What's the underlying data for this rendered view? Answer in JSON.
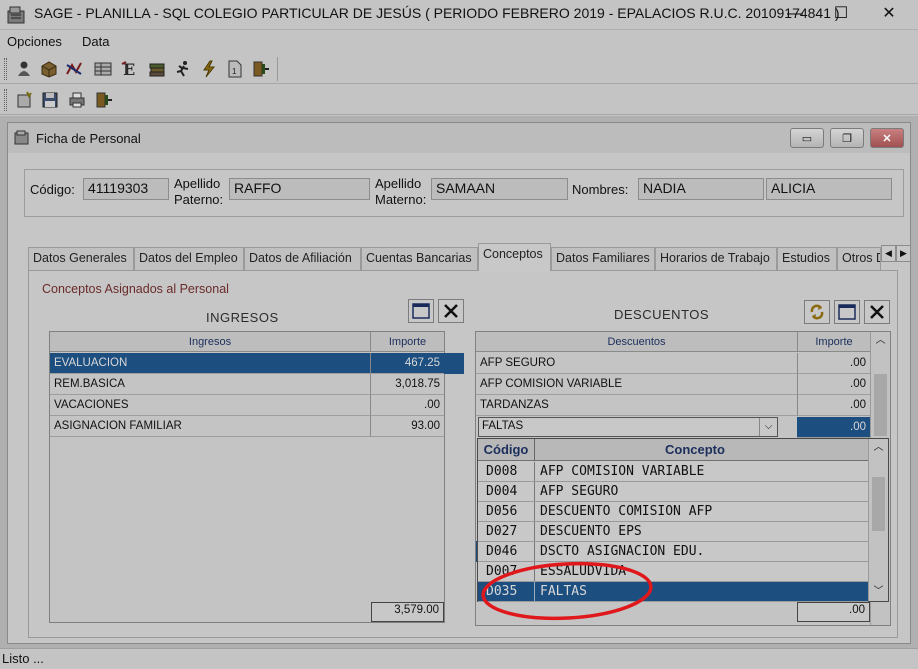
{
  "window": {
    "title": "SAGE - PLANILLA - SQL  COLEGIO PARTICULAR DE JESÚS ( PERIODO FEBRERO 2019 - EPALACIOS  R.U.C. 20109174841 )",
    "minimize": "—",
    "maximize": "☐",
    "close": "✕"
  },
  "menu": {
    "items": [
      "Opciones",
      "Data"
    ]
  },
  "child": {
    "title": "Ficha de Personal",
    "minimize": "▭",
    "restore": "❐",
    "close": "✕"
  },
  "employee": {
    "codigo_label": "Código:",
    "codigo": "41119303",
    "ap_paterno_label_1": "Apellido",
    "ap_paterno_label_2": "Paterno:",
    "ap_paterno": "RAFFO",
    "ap_materno_label_1": "Apellido",
    "ap_materno_label_2": "Materno:",
    "ap_materno": "SAMAAN",
    "nombres_label": "Nombres:",
    "nombre1": "NADIA",
    "nombre2": "ALICIA"
  },
  "tabs": [
    "Datos Generales",
    "Datos del Empleo",
    "Datos de Afiliación",
    "Cuentas Bancarias",
    "Conceptos",
    "Datos Familiares",
    "Horarios de Trabajo",
    "Estudios",
    "Otros D"
  ],
  "active_tab": "Conceptos",
  "conceptos": {
    "group_title": "Conceptos Asignados al Personal",
    "ingresos": {
      "title": "INGRESOS",
      "col_concept": "Ingresos",
      "col_amount": "Importe",
      "rows": [
        {
          "name": "EVALUACION",
          "amount": "467.25"
        },
        {
          "name": "REM.BASICA",
          "amount": "3,018.75"
        },
        {
          "name": "VACACIONES",
          "amount": ".00"
        },
        {
          "name": "ASIGNACION FAMILIAR",
          "amount": "93.00"
        }
      ],
      "total": "3,579.00"
    },
    "descuentos": {
      "title": "DESCUENTOS",
      "col_concept": "Descuentos",
      "col_amount": "Importe",
      "rows": [
        {
          "name": "AFP SEGURO",
          "amount": ".00"
        },
        {
          "name": "AFP COMISION VARIABLE",
          "amount": ".00"
        },
        {
          "name": "TARDANZAS",
          "amount": ".00"
        }
      ],
      "edit_row": {
        "name": "FALTAS",
        "amount": ".00"
      },
      "total": ".00"
    },
    "dropdown": {
      "col_code": "Código",
      "col_concept": "Concepto",
      "rows": [
        {
          "code": "D008",
          "concept": "AFP COMISION VARIABLE"
        },
        {
          "code": "D004",
          "concept": "AFP SEGURO"
        },
        {
          "code": "D056",
          "concept": "DESCUENTO COMISION AFP"
        },
        {
          "code": "D027",
          "concept": "DESCUENTO EPS"
        },
        {
          "code": "D046",
          "concept": "DSCTO  ASIGNACION EDU."
        },
        {
          "code": "D007",
          "concept": "ESSALUDVIDA"
        },
        {
          "code": "D035",
          "concept": "FALTAS"
        }
      ],
      "selected_code": "D035"
    }
  },
  "status": {
    "text": "Listo ..."
  },
  "colors": {
    "selection": "#1c4e80",
    "annotation_circle": "#e0181c"
  }
}
